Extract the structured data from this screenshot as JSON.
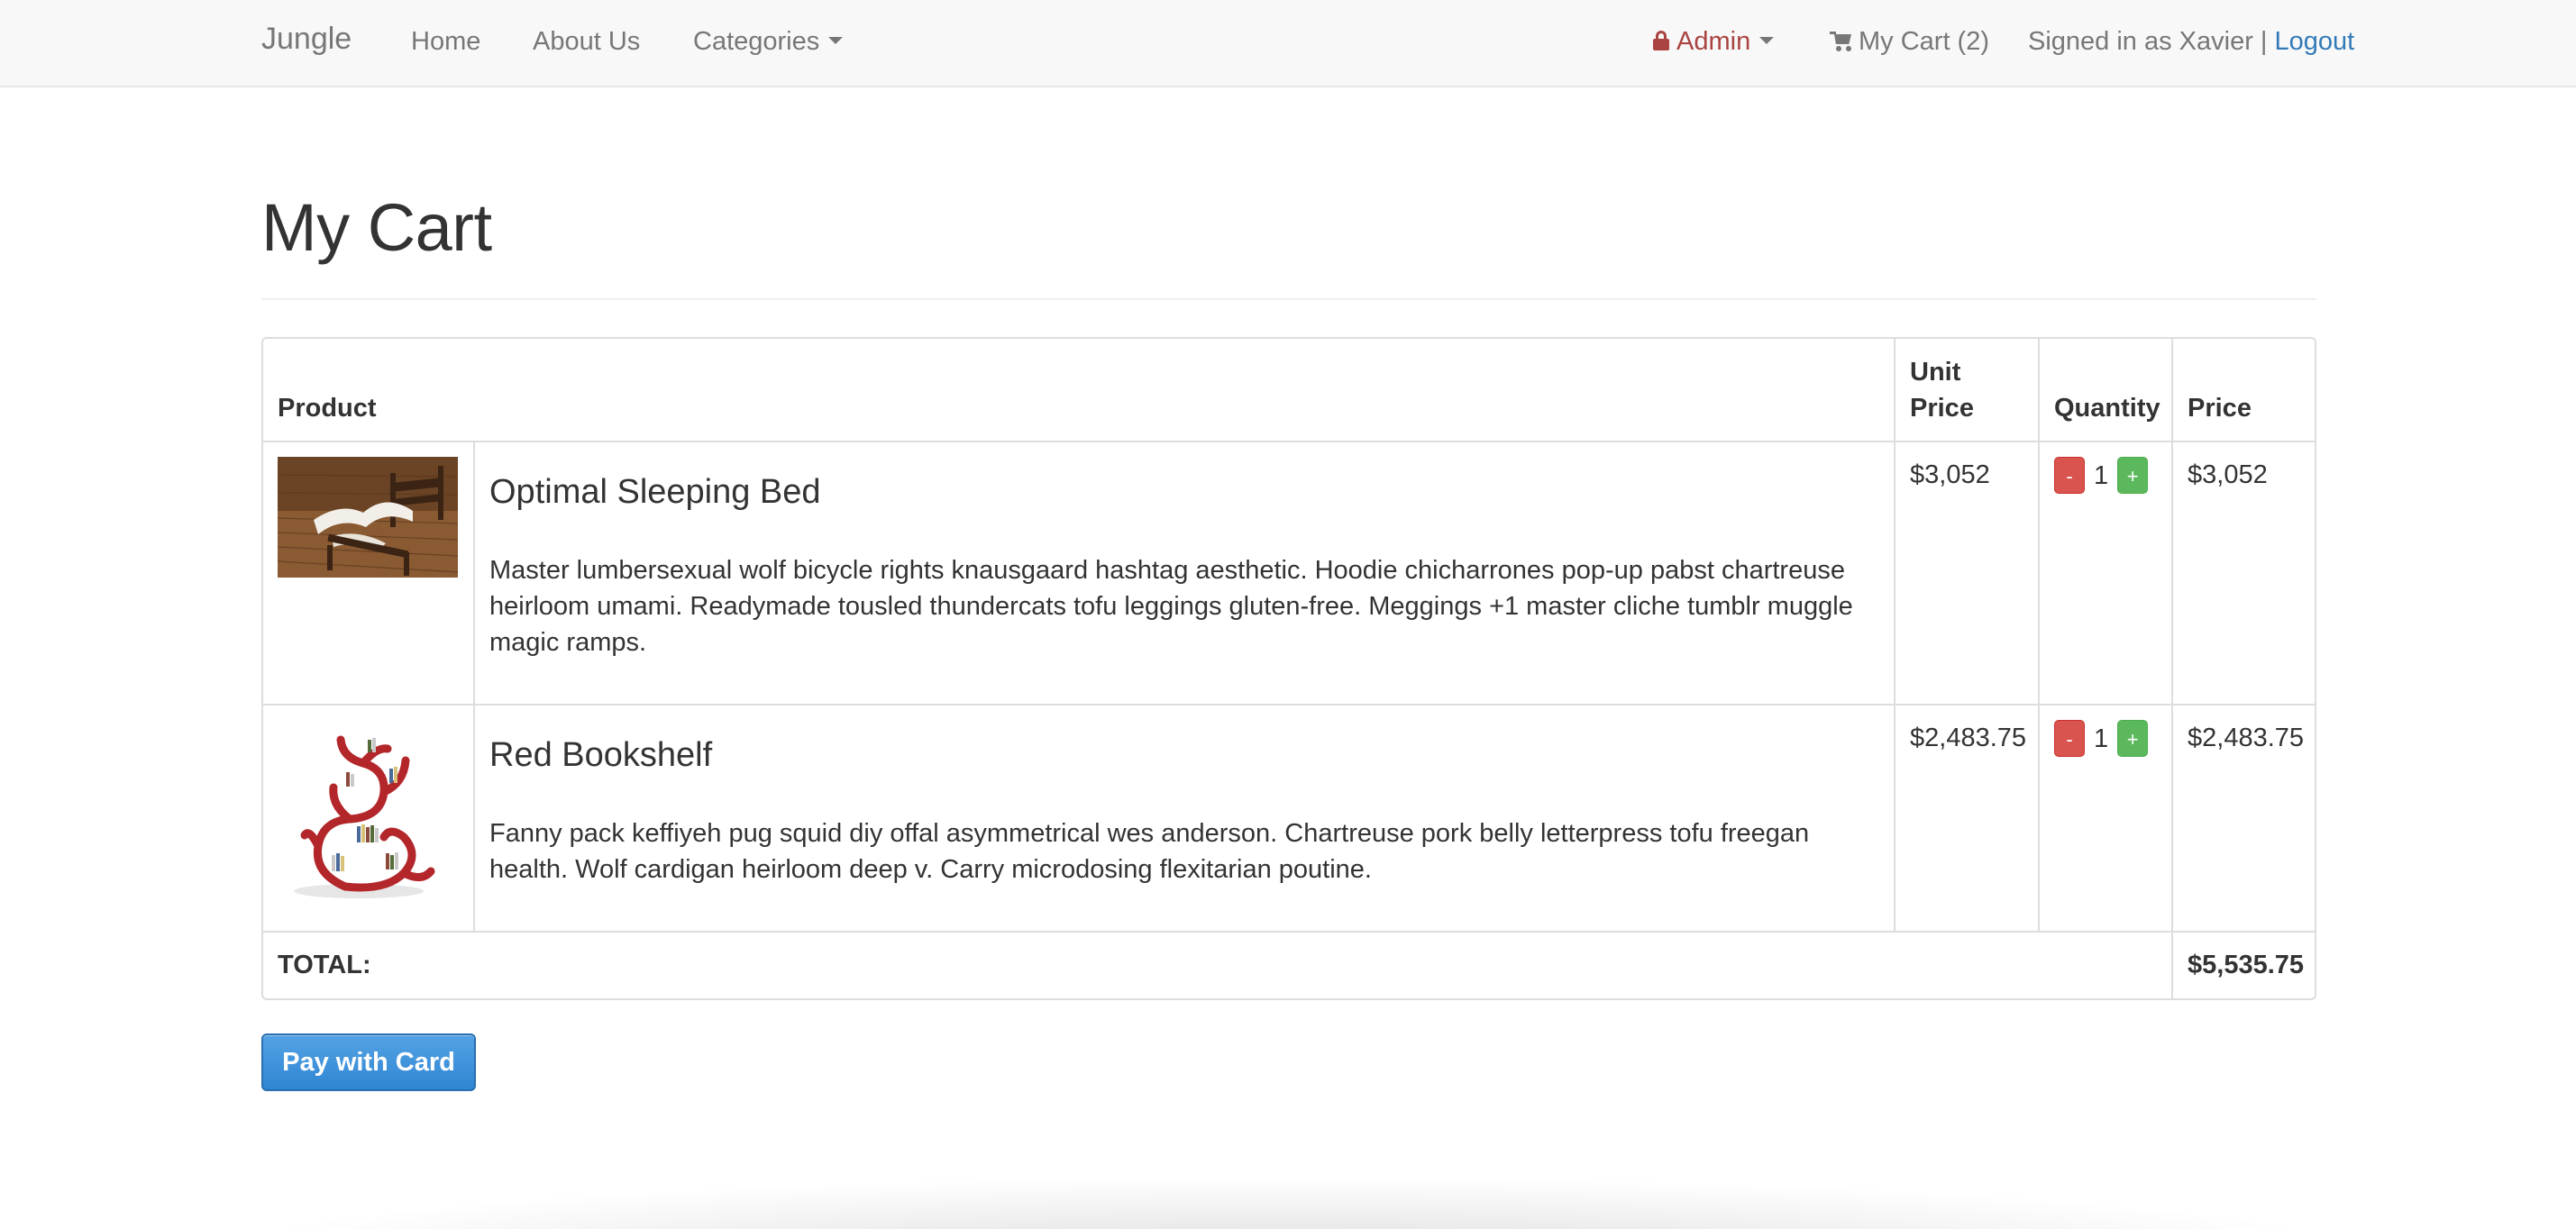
{
  "navbar": {
    "brand": "Jungle",
    "links": {
      "home": "Home",
      "about": "About Us",
      "categories": "Categories"
    },
    "admin": "Admin",
    "cart": "My Cart (2)",
    "signed_in": "Signed in as Xavier | ",
    "logout": "Logout",
    "icons": {
      "admin": "lock-icon",
      "cart": "shopping-cart-icon"
    },
    "colors": {
      "admin": "#a94442",
      "logout": "#337ab7"
    }
  },
  "page": {
    "title": "My Cart"
  },
  "table": {
    "headers": {
      "product": "Product",
      "unit_price": "Unit Price",
      "quantity": "Quantity",
      "price": "Price"
    },
    "items": [
      {
        "name": "Optimal Sleeping Bed",
        "description": "Master lumbersexual wolf bicycle rights knausgaard hashtag aesthetic. Hoodie chicharrones pop-up pabst chartreuse heirloom umami. Readymade tousled thundercats tofu leggings gluten-free. Meggings +1 master cliche tumblr muggle magic ramps.",
        "unit_price": "$3,052",
        "quantity": "1",
        "price": "$3,052",
        "image": "bed-image"
      },
      {
        "name": "Red Bookshelf",
        "description": "Fanny pack keffiyeh pug squid diy offal asymmetrical wes anderson. Chartreuse pork belly letterpress tofu freegan health. Wolf cardigan heirloom deep v. Carry microdosing flexitarian poutine.",
        "unit_price": "$2,483.75",
        "quantity": "1",
        "price": "$2,483.75",
        "image": "bookshelf-image"
      }
    ],
    "minus": "-",
    "plus": "+",
    "total_label": "TOTAL:",
    "total_value": "$5,535.75"
  },
  "pay_button": "Pay with Card",
  "colors": {
    "minus": "#d9534f",
    "plus": "#5cb85c",
    "pay": "#2f86d3"
  }
}
